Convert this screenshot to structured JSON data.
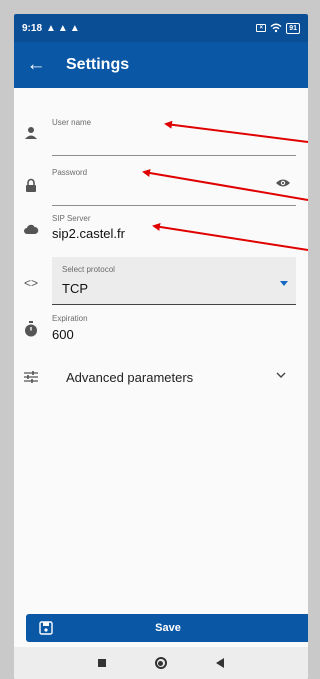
{
  "statusbar": {
    "time": "9:18",
    "battery": "91"
  },
  "appbar": {
    "title": "Settings"
  },
  "fields": {
    "username": {
      "label": "User name",
      "value": ""
    },
    "password": {
      "label": "Password",
      "value": ""
    },
    "sip_server": {
      "label": "SIP Server",
      "value": "sip2.castel.fr"
    },
    "protocol": {
      "label": "Select protocol",
      "value": "TCP"
    },
    "expiration": {
      "label": "Expiration",
      "value": "600"
    }
  },
  "advanced": {
    "label": "Advanced parameters"
  },
  "save": {
    "label": "Save"
  },
  "colors": {
    "primary": "#0a57a6",
    "status": "#0a4f96",
    "annotation": "#e00000"
  }
}
